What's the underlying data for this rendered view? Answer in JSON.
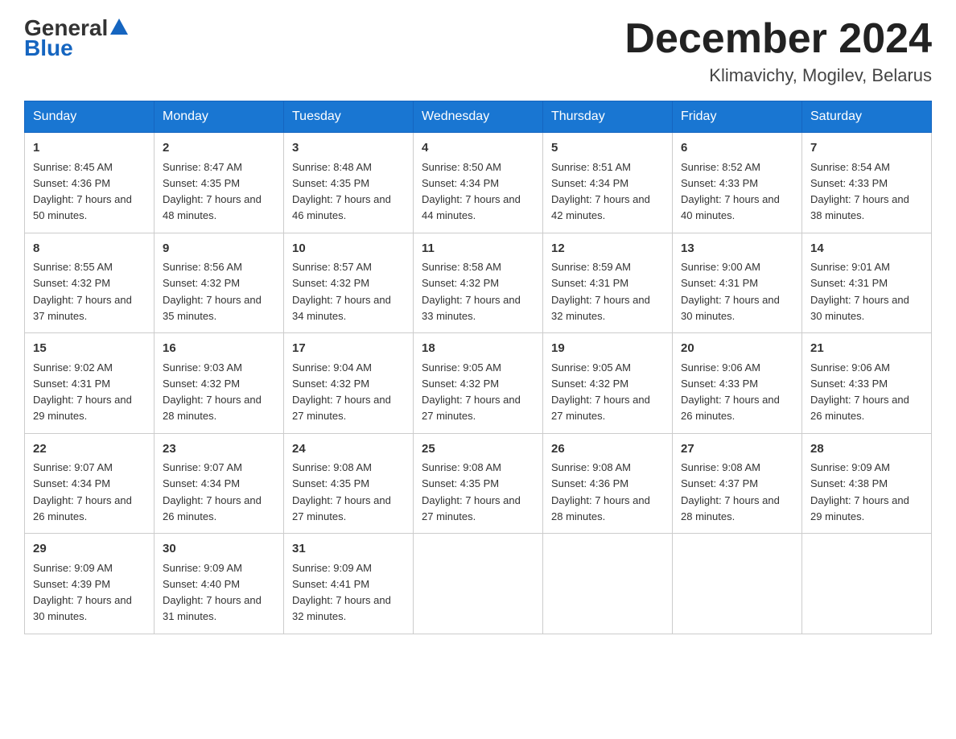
{
  "header": {
    "logo_general": "General",
    "logo_blue": "Blue",
    "month_title": "December 2024",
    "location": "Klimavichy, Mogilev, Belarus"
  },
  "days_of_week": [
    "Sunday",
    "Monday",
    "Tuesday",
    "Wednesday",
    "Thursday",
    "Friday",
    "Saturday"
  ],
  "weeks": [
    [
      {
        "day": "1",
        "sunrise": "8:45 AM",
        "sunset": "4:36 PM",
        "daylight": "7 hours and 50 minutes."
      },
      {
        "day": "2",
        "sunrise": "8:47 AM",
        "sunset": "4:35 PM",
        "daylight": "7 hours and 48 minutes."
      },
      {
        "day": "3",
        "sunrise": "8:48 AM",
        "sunset": "4:35 PM",
        "daylight": "7 hours and 46 minutes."
      },
      {
        "day": "4",
        "sunrise": "8:50 AM",
        "sunset": "4:34 PM",
        "daylight": "7 hours and 44 minutes."
      },
      {
        "day": "5",
        "sunrise": "8:51 AM",
        "sunset": "4:34 PM",
        "daylight": "7 hours and 42 minutes."
      },
      {
        "day": "6",
        "sunrise": "8:52 AM",
        "sunset": "4:33 PM",
        "daylight": "7 hours and 40 minutes."
      },
      {
        "day": "7",
        "sunrise": "8:54 AM",
        "sunset": "4:33 PM",
        "daylight": "7 hours and 38 minutes."
      }
    ],
    [
      {
        "day": "8",
        "sunrise": "8:55 AM",
        "sunset": "4:32 PM",
        "daylight": "7 hours and 37 minutes."
      },
      {
        "day": "9",
        "sunrise": "8:56 AM",
        "sunset": "4:32 PM",
        "daylight": "7 hours and 35 minutes."
      },
      {
        "day": "10",
        "sunrise": "8:57 AM",
        "sunset": "4:32 PM",
        "daylight": "7 hours and 34 minutes."
      },
      {
        "day": "11",
        "sunrise": "8:58 AM",
        "sunset": "4:32 PM",
        "daylight": "7 hours and 33 minutes."
      },
      {
        "day": "12",
        "sunrise": "8:59 AM",
        "sunset": "4:31 PM",
        "daylight": "7 hours and 32 minutes."
      },
      {
        "day": "13",
        "sunrise": "9:00 AM",
        "sunset": "4:31 PM",
        "daylight": "7 hours and 30 minutes."
      },
      {
        "day": "14",
        "sunrise": "9:01 AM",
        "sunset": "4:31 PM",
        "daylight": "7 hours and 30 minutes."
      }
    ],
    [
      {
        "day": "15",
        "sunrise": "9:02 AM",
        "sunset": "4:31 PM",
        "daylight": "7 hours and 29 minutes."
      },
      {
        "day": "16",
        "sunrise": "9:03 AM",
        "sunset": "4:32 PM",
        "daylight": "7 hours and 28 minutes."
      },
      {
        "day": "17",
        "sunrise": "9:04 AM",
        "sunset": "4:32 PM",
        "daylight": "7 hours and 27 minutes."
      },
      {
        "day": "18",
        "sunrise": "9:05 AM",
        "sunset": "4:32 PM",
        "daylight": "7 hours and 27 minutes."
      },
      {
        "day": "19",
        "sunrise": "9:05 AM",
        "sunset": "4:32 PM",
        "daylight": "7 hours and 27 minutes."
      },
      {
        "day": "20",
        "sunrise": "9:06 AM",
        "sunset": "4:33 PM",
        "daylight": "7 hours and 26 minutes."
      },
      {
        "day": "21",
        "sunrise": "9:06 AM",
        "sunset": "4:33 PM",
        "daylight": "7 hours and 26 minutes."
      }
    ],
    [
      {
        "day": "22",
        "sunrise": "9:07 AM",
        "sunset": "4:34 PM",
        "daylight": "7 hours and 26 minutes."
      },
      {
        "day": "23",
        "sunrise": "9:07 AM",
        "sunset": "4:34 PM",
        "daylight": "7 hours and 26 minutes."
      },
      {
        "day": "24",
        "sunrise": "9:08 AM",
        "sunset": "4:35 PM",
        "daylight": "7 hours and 27 minutes."
      },
      {
        "day": "25",
        "sunrise": "9:08 AM",
        "sunset": "4:35 PM",
        "daylight": "7 hours and 27 minutes."
      },
      {
        "day": "26",
        "sunrise": "9:08 AM",
        "sunset": "4:36 PM",
        "daylight": "7 hours and 28 minutes."
      },
      {
        "day": "27",
        "sunrise": "9:08 AM",
        "sunset": "4:37 PM",
        "daylight": "7 hours and 28 minutes."
      },
      {
        "day": "28",
        "sunrise": "9:09 AM",
        "sunset": "4:38 PM",
        "daylight": "7 hours and 29 minutes."
      }
    ],
    [
      {
        "day": "29",
        "sunrise": "9:09 AM",
        "sunset": "4:39 PM",
        "daylight": "7 hours and 30 minutes."
      },
      {
        "day": "30",
        "sunrise": "9:09 AM",
        "sunset": "4:40 PM",
        "daylight": "7 hours and 31 minutes."
      },
      {
        "day": "31",
        "sunrise": "9:09 AM",
        "sunset": "4:41 PM",
        "daylight": "7 hours and 32 minutes."
      },
      null,
      null,
      null,
      null
    ]
  ],
  "labels": {
    "sunrise_prefix": "Sunrise: ",
    "sunset_prefix": "Sunset: ",
    "daylight_prefix": "Daylight: "
  }
}
